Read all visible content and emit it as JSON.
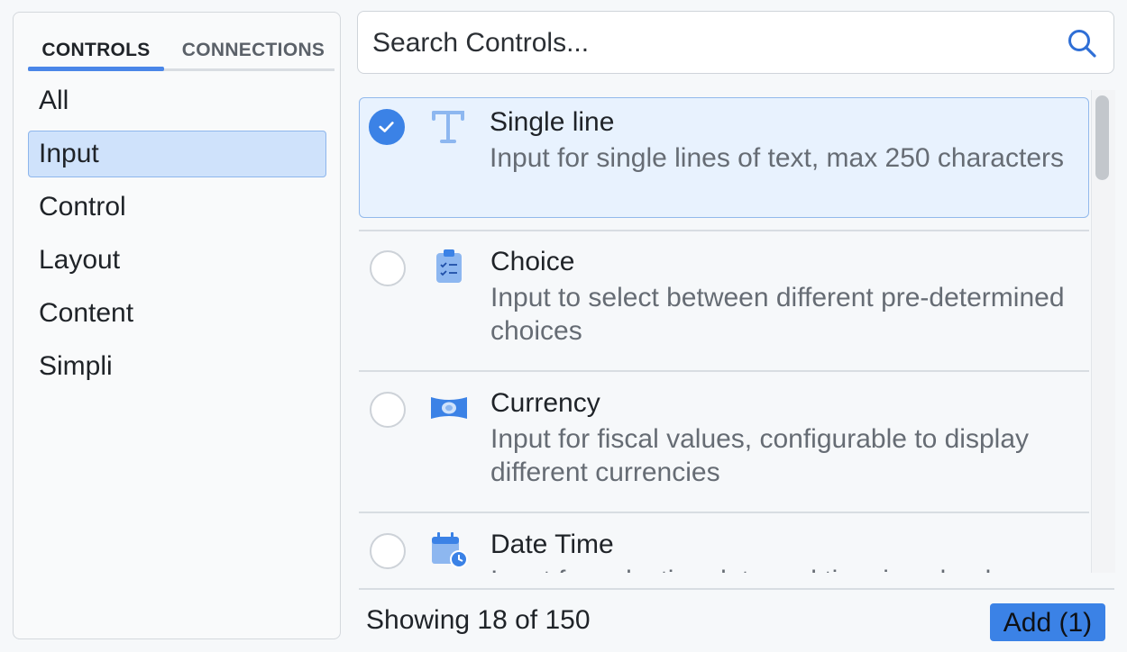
{
  "tabs": [
    {
      "label": "CONTROLS",
      "active": true
    },
    {
      "label": "CONNECTIONS",
      "active": false
    }
  ],
  "categories": [
    {
      "label": "All",
      "active": false
    },
    {
      "label": "Input",
      "active": true
    },
    {
      "label": "Control",
      "active": false
    },
    {
      "label": "Layout",
      "active": false
    },
    {
      "label": "Content",
      "active": false
    },
    {
      "label": "Simpli",
      "active": false
    }
  ],
  "search": {
    "placeholder": "Search Controls...",
    "value": "",
    "icon": "search-icon"
  },
  "items": [
    {
      "title": "Single line",
      "description": "Input for single lines of text, max 250 characters",
      "icon": "text-icon",
      "selected": true
    },
    {
      "title": "Choice",
      "description": "Input to select between different pre-determined choices",
      "icon": "clipboard-checklist-icon",
      "selected": false
    },
    {
      "title": "Currency",
      "description": "Input for fiscal values, configurable to display different currencies",
      "icon": "banknote-icon",
      "selected": false
    },
    {
      "title": "Date Time",
      "description": "Input for selecting date and time in calendar",
      "icon": "calendar-clock-icon",
      "selected": false
    }
  ],
  "footer": {
    "count_text": "Showing 18 of 150",
    "add_label": "Add (1)"
  },
  "colors": {
    "accent": "#3b82e6",
    "selected_bg": "#e8f2fe",
    "icon_light": "#8db7f0"
  }
}
